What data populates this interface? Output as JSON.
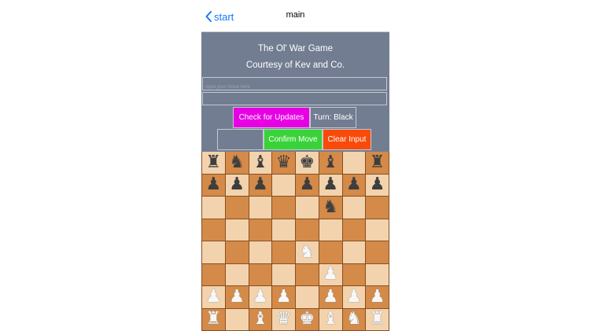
{
  "nav": {
    "back_label": "start",
    "title": "main"
  },
  "header": {
    "line1": "The Ol' War Game",
    "line2": "Courtesy of Kev and Co."
  },
  "inputs": {
    "move_placeholder": "Input your move here",
    "move_value": "",
    "second_value": ""
  },
  "buttons": {
    "updates_label": "Check for Updates",
    "turn_label": "Turn: Black",
    "blank_label": "",
    "confirm_label": "Confirm Move",
    "clear_label": "Clear Input"
  },
  "colors": {
    "panel": "#727d91",
    "updates": "#e600e3",
    "confirm": "#39d339",
    "clear": "#f94a0a",
    "light_square": "#f2d3ad",
    "dark_square": "#d48a48"
  },
  "board": {
    "rows": [
      [
        "bR",
        "bN",
        "bB",
        "bQ",
        "bK",
        "bB",
        "",
        "bR"
      ],
      [
        "bP",
        "bP",
        "bP",
        "",
        "bP",
        "bP",
        "bP",
        "bP"
      ],
      [
        "",
        "",
        "",
        "",
        "",
        "bN",
        "",
        ""
      ],
      [
        "",
        "",
        "",
        "",
        "",
        "",
        "",
        ""
      ],
      [
        "",
        "",
        "",
        "",
        "wN",
        "",
        "",
        ""
      ],
      [
        "",
        "",
        "",
        "",
        "",
        "wP",
        "",
        ""
      ],
      [
        "wP",
        "wP",
        "wP",
        "wP",
        "",
        "wP",
        "wP",
        "wP"
      ],
      [
        "wR",
        "",
        "wB",
        "wQ",
        "wK",
        "wB",
        "wN",
        "wR"
      ]
    ]
  }
}
